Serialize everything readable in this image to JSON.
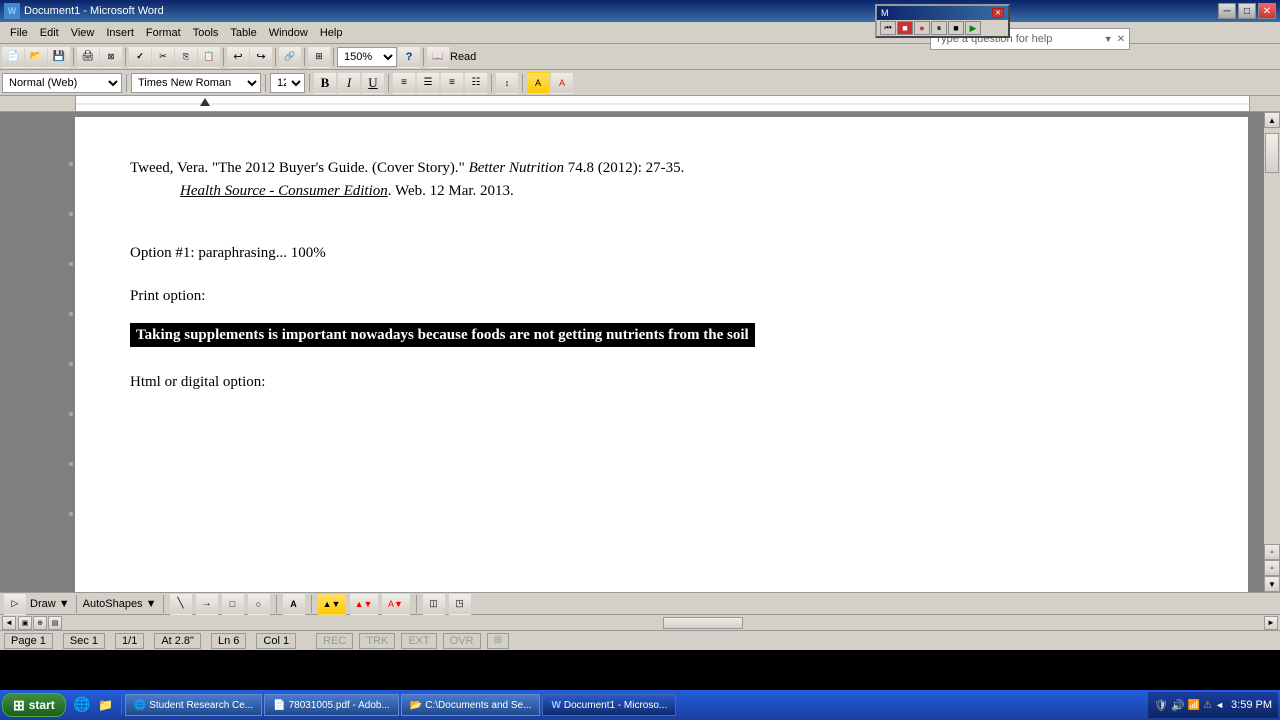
{
  "titleBar": {
    "title": "Document1 - Microsoft Word",
    "icon": "W",
    "minBtn": "─",
    "maxBtn": "□",
    "closeBtn": "✕"
  },
  "menuBar": {
    "items": [
      "File",
      "Edit",
      "View",
      "Insert",
      "Format",
      "Tools",
      "Table",
      "Window",
      "Help"
    ]
  },
  "formatToolbar": {
    "style": "Normal (Web)",
    "font": "Times New Roman",
    "size": "12",
    "boldLabel": "B",
    "italicLabel": "I",
    "underlineLabel": "U"
  },
  "helpBox": {
    "placeholder": "Type a question for help"
  },
  "document": {
    "citation": {
      "author": "Tweed, Vera. \"The 2012 Buyer's Guide. (Cover Story).\" ",
      "journal": "Better Nutrition",
      "details": " 74.8 (2012): 27-35.",
      "source": "Health Source - Consumer Edition",
      "sourceEnd": ". Web. 12 Mar. 2013."
    },
    "option1": "Option #1: paraphrasing... 100%",
    "printOption": "Print option:",
    "highlightedText": "Taking supplements is important nowadays because foods are not getting nutrients from the soil",
    "htmlOption": "Html or digital option:"
  },
  "statusBar": {
    "page": "Page 1",
    "sec": "Sec 1",
    "pageOf": "1/1",
    "at": "At 2.8\"",
    "ln": "Ln 6",
    "col": "Col 1",
    "rec": "REC",
    "trk": "TRK",
    "ext": "EXT",
    "ovr": "OVR"
  },
  "bottomToolbar": {
    "draw": "Draw ▼",
    "autoShapes": "AutoShapes ▼"
  },
  "taskbar": {
    "startLabel": "start",
    "items": [
      "Student Research Ce...",
      "78031005.pdf - Adob...",
      "C:\\Documents and Se...",
      "Document1 - Microso..."
    ],
    "clock": "3:59 PM"
  },
  "mediaPlayer": {
    "title": "M",
    "buttons": [
      "■",
      "●",
      "⏸",
      "■",
      "▶"
    ]
  }
}
